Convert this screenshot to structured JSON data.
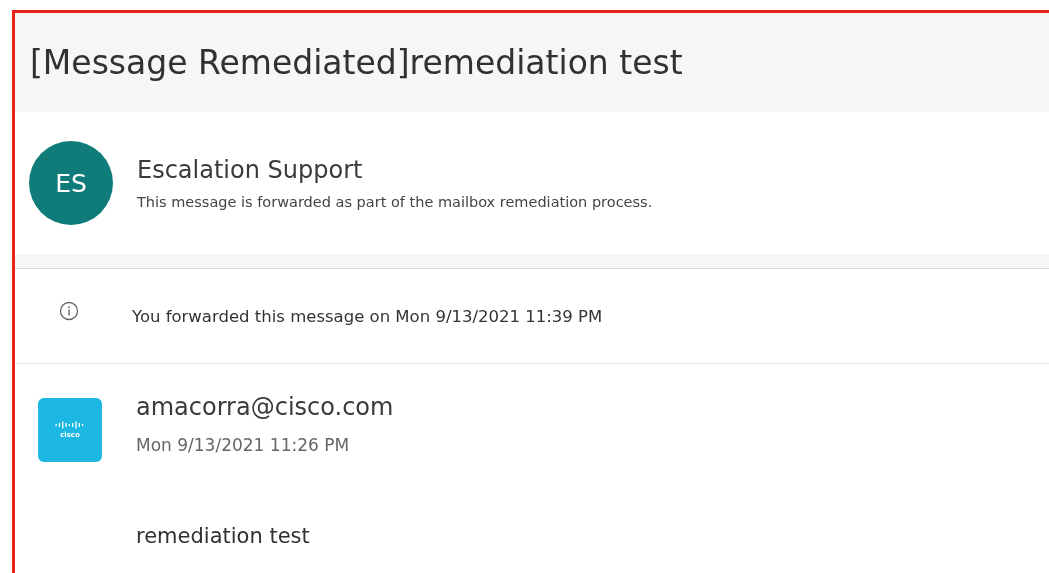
{
  "subject": "[Message Remediated]remediation test",
  "notice_sender": {
    "initials": "ES",
    "color": "#107c7a",
    "name": "Escalation Support",
    "note": "This message is forwarded as part of the mailbox remediation process."
  },
  "info_bar": {
    "text": "You forwarded this message on Mon 9/13/2021 11:39 PM"
  },
  "message": {
    "logo_text": "cisco",
    "sender": "amacorra@cisco.com",
    "date": "Mon 9/13/2021 11:26 PM",
    "body": "remediation test"
  }
}
